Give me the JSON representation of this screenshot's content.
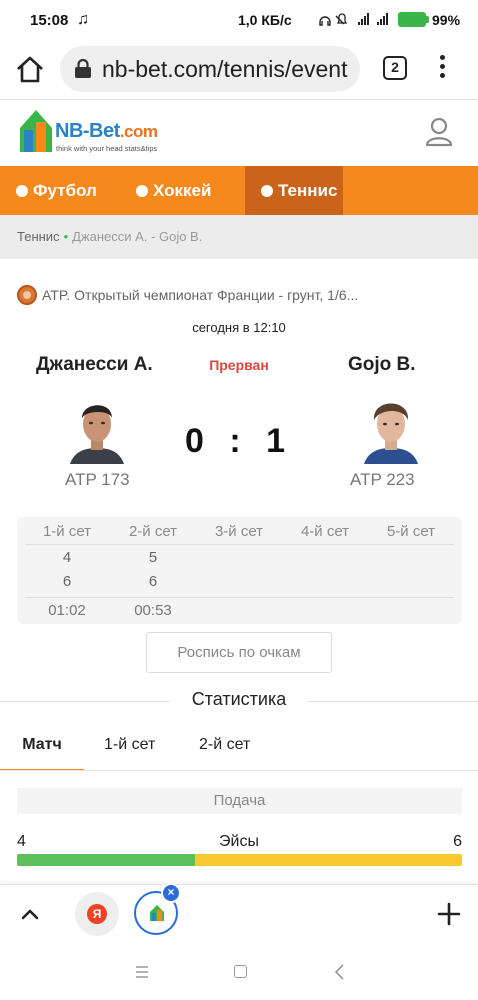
{
  "status_bar": {
    "time": "15:08",
    "note_icon": "♫",
    "speed": "1,0 КБ/с",
    "network": "4G+",
    "battery_pct": "99%",
    "battery_color": "#3bb54a"
  },
  "browser": {
    "url": "nb-bet.com/tennis/event",
    "tab_count": "2"
  },
  "site": {
    "logo_name": "NB-Bet",
    "logo_tld": ".com",
    "logo_tagline": "think with your head stats&tips",
    "brand_color": "#f5891e",
    "nav": [
      {
        "label": "Футбол"
      },
      {
        "label": "Хоккей"
      },
      {
        "label": "Теннис"
      }
    ]
  },
  "breadcrumb": {
    "home": "Теннис",
    "separator": "•",
    "current": "Джанесси А. - Gojo B."
  },
  "match": {
    "tournament": "ATP. Открытый чемпионат Франции - грунт, 1/6...",
    "date": "сегодня в 12:10",
    "status": "Прерван",
    "home": {
      "name": "Джанесси А.",
      "rank": "ATP 173"
    },
    "away": {
      "name": "Gojo B.",
      "rank": "ATP 223"
    },
    "score": "0 : 1",
    "sets": [
      {
        "header": "1-й сет",
        "home": "4",
        "away": "6",
        "duration": "01:02"
      },
      {
        "header": "2-й сет",
        "home": "5",
        "away": "6",
        "duration": "00:53"
      },
      {
        "header": "3-й сет",
        "home": "",
        "away": "",
        "duration": ""
      },
      {
        "header": "4-й сет",
        "home": "",
        "away": "",
        "duration": ""
      },
      {
        "header": "5-й сет",
        "home": "",
        "away": "",
        "duration": ""
      }
    ],
    "point_by_point_button": "Роспись по очкам"
  },
  "statistics": {
    "title": "Статистика",
    "tabs": [
      {
        "label": "Матч"
      },
      {
        "label": "1-й сет"
      },
      {
        "label": "2-й сет"
      }
    ],
    "section": "Подача",
    "rows": [
      {
        "label": "Эйсы",
        "home": "4",
        "away": "6",
        "home_share": 0.4
      }
    ],
    "home_color": "#5bbf5a",
    "away_color": "#f9c932"
  },
  "bottom_bar": {
    "yandex_label": "Я",
    "close_label": "×"
  }
}
